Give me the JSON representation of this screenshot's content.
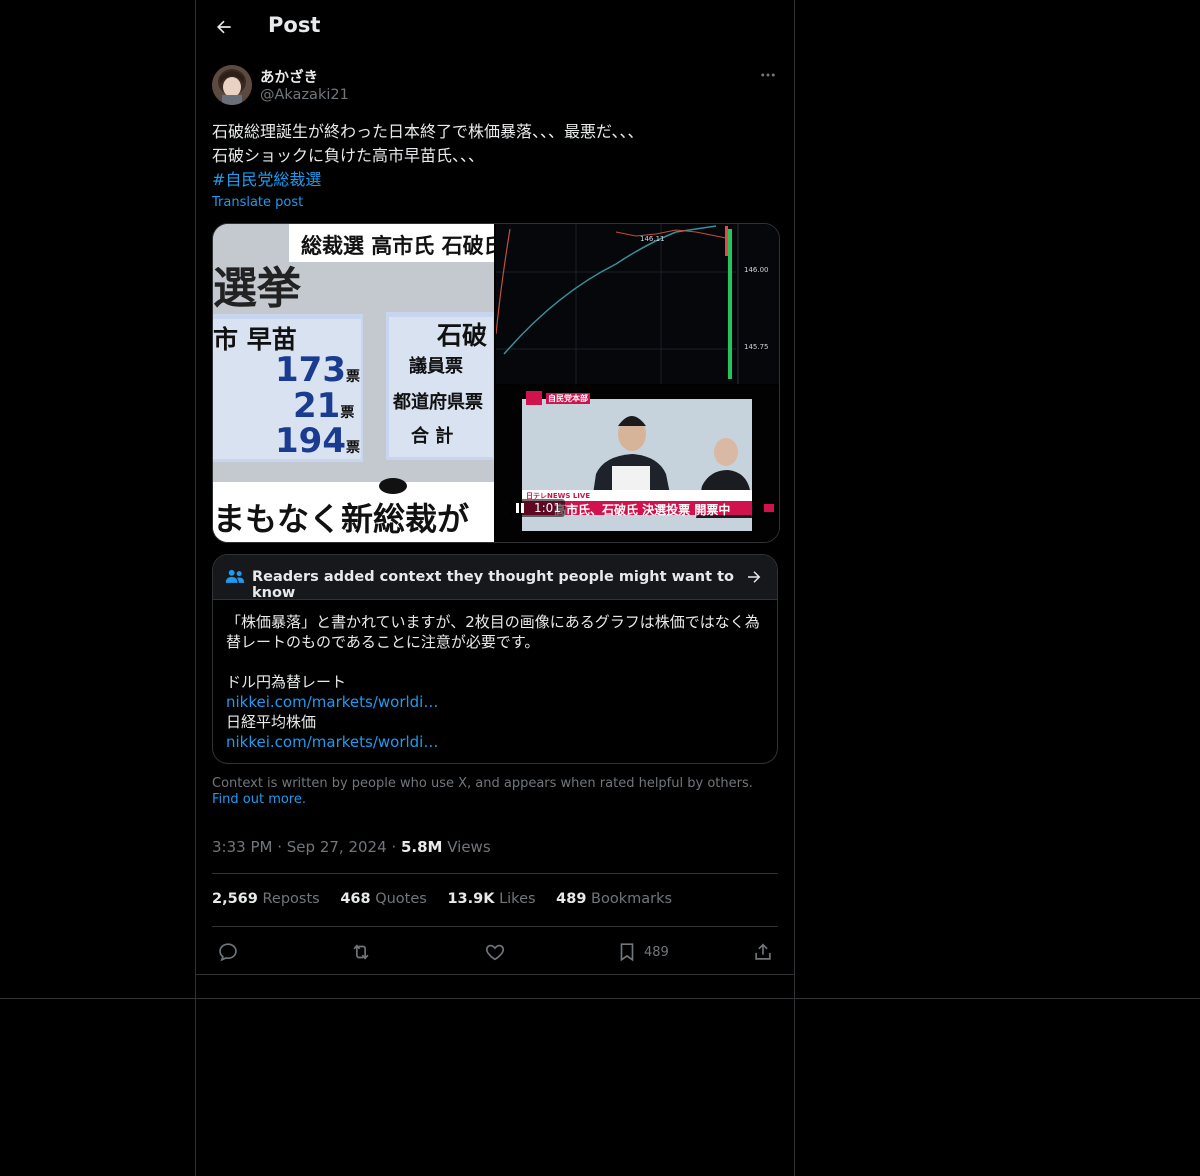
{
  "header": {
    "title": "Post",
    "back_icon": "arrow-left-icon"
  },
  "author": {
    "name": "あかざき",
    "handle": "@Akazaki21"
  },
  "post": {
    "lines": [
      "石破総理誕生が終わった日本終了で株価暴落、、、最悪だ、、、",
      "石破ショックに負けた高市早苗氏、、、"
    ],
    "hashtag": "#自民党総裁選",
    "translate": "Translate post"
  },
  "media": {
    "left": {
      "banner": "総裁選 高市氏 石破氏",
      "big_text": "選挙",
      "name_left": "市 早苗",
      "name_right": "石破",
      "votes": [
        "173",
        "21",
        "194"
      ],
      "unit": "票",
      "labels": [
        "議員票",
        "都道府県票",
        "合 計"
      ],
      "caption": "まもなく新総裁が"
    },
    "chart": {
      "top_label": "146.11",
      "right_labels": [
        "146.00",
        "145.75"
      ]
    },
    "video": {
      "badge": "自民党本部",
      "channel": "日テレNEWS LIVE",
      "lower": "高市氏、石破氏 決選投票 開票中",
      "time": "1:01",
      "pause_icon": "pause-icon"
    }
  },
  "community_note": {
    "title": "Readers added context they thought people might want to know",
    "body": [
      "「株価暴落」と書かれていますが、2枚目の画像にあるグラフは株価ではなく為",
      "替レートのものであることに注意が必要です。"
    ],
    "label1": "ドル円為替レート",
    "link1": "nikkei.com/markets/worldi…",
    "label2": "日経平均株価",
    "link2": "nikkei.com/markets/worldi…"
  },
  "disclaimer": {
    "text": "Context is written by people who use X, and appears when rated helpful by others.",
    "link": "Find out more."
  },
  "meta": {
    "time": "3:33 PM",
    "date": "Sep 27, 2024",
    "views_count": "5.8M",
    "views_label": "Views"
  },
  "stats": [
    {
      "num": "2,569",
      "label": "Reposts"
    },
    {
      "num": "468",
      "label": "Quotes"
    },
    {
      "num": "13.9K",
      "label": "Likes"
    },
    {
      "num": "489",
      "label": "Bookmarks"
    }
  ],
  "actions": {
    "bookmark_count": "489"
  },
  "colors": {
    "background": "#000000",
    "text": "#e7e9ea",
    "muted": "#71767b",
    "accent": "#1d9bf0",
    "border": "#2f3336"
  }
}
